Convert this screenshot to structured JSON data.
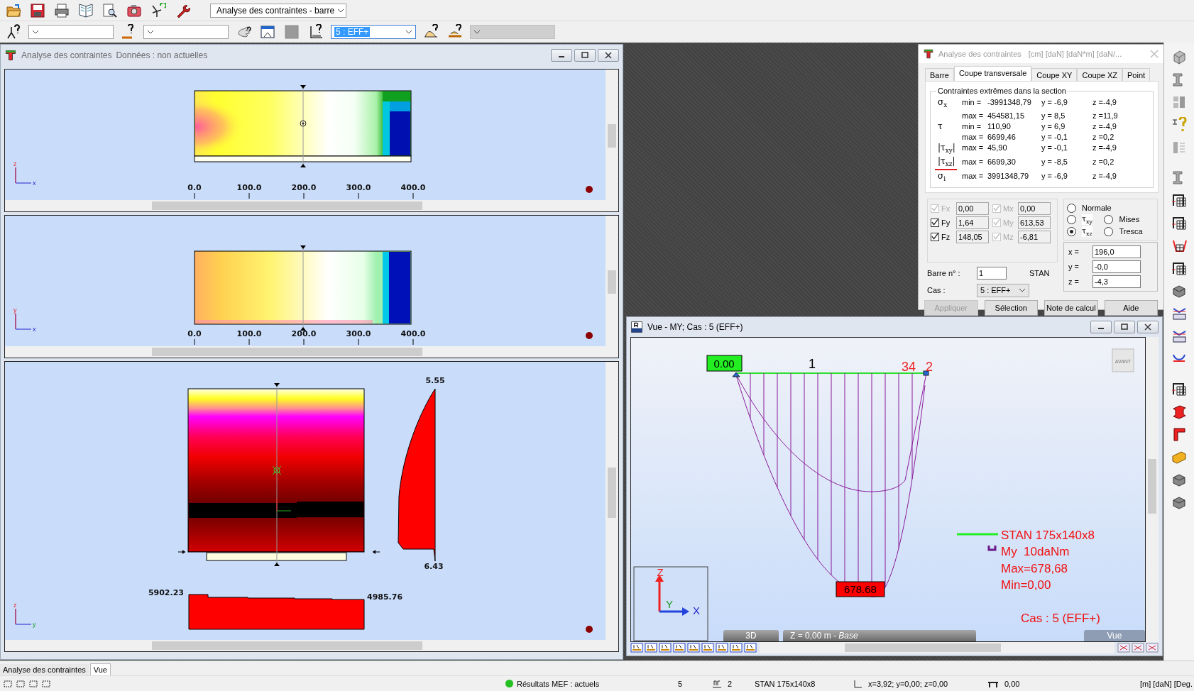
{
  "toolbar": {
    "view_combo": "Analyse des contraintes - barre",
    "case_combo": "5 : EFF+"
  },
  "stress_window": {
    "title": "Analyse des contraintes",
    "subtitle": "Données : non actuelles",
    "panes": [
      {
        "kind": "elevation",
        "axes": [
          "z",
          "x"
        ],
        "ruler": [
          "0.0",
          "100.0",
          "200.0",
          "300.0",
          "400.0"
        ]
      },
      {
        "kind": "plan",
        "axes": [
          "y",
          "x"
        ],
        "ruler": [
          "0.0",
          "100.0",
          "200.0",
          "300.0",
          "400.0"
        ]
      },
      {
        "kind": "section",
        "axes": [
          "z",
          "y"
        ],
        "side_labels": [
          "5.55",
          "6.43"
        ],
        "bottom_labels": [
          "5902.23",
          "4985.76"
        ]
      }
    ]
  },
  "dialog": {
    "title": "Analyse des contraintes",
    "units": "[cm] [daN] [daN*m] [daN/...",
    "tabs": [
      {
        "label": "Barre",
        "selected": false
      },
      {
        "label": "Coupe transversale",
        "selected": true
      },
      {
        "label": "Coupe XY",
        "selected": false
      },
      {
        "label": "Coupe XZ",
        "selected": false
      },
      {
        "label": "Point",
        "selected": false
      }
    ],
    "group_title": "Contraintes extrêmes dans la section",
    "rows": [
      {
        "symbol": "σ$_{x}$",
        "label": "min =",
        "value": "-3991348,79",
        "y": "y = -6,9",
        "z": "z =-4,9",
        "highlighted": false
      },
      {
        "label": "max =",
        "value": "454581,15",
        "y": "y = 8,5",
        "z": "z =11,9",
        "highlighted": false
      },
      {
        "symbol": "τ",
        "label": "min =",
        "value": "110,90",
        "y": "y = 6,9",
        "z": "z =-4,9",
        "highlighted": false
      },
      {
        "label": "max =",
        "value": "6699,46",
        "y": "y = -0,1",
        "z": "z =0,2",
        "highlighted": false
      },
      {
        "symbol": "|τ$_{xy}$|",
        "label": "max =",
        "value": "45,90",
        "y": "y = -0,1",
        "z": "z =-4,9",
        "highlighted": false
      },
      {
        "symbol": "|τ$_{xz}$|",
        "label": "max =",
        "value": "6699,30",
        "y": "y = -8,5",
        "z": "z =0,2",
        "highlighted": true
      },
      {
        "symbol": "σ$_{i}$",
        "label": "max =",
        "value": "3991348,79",
        "y": "y = -6,9",
        "z": "z =-4,9",
        "highlighted": false
      }
    ],
    "forces": [
      {
        "label": "Fx",
        "value": "0,00",
        "checked": true,
        "disabled": true
      },
      {
        "label": "Mx",
        "value": "0,00",
        "checked": true,
        "disabled": true
      },
      {
        "label": "Fy",
        "value": "1,64",
        "checked": true,
        "disabled": false
      },
      {
        "label": "My",
        "value": "613,53",
        "checked": true,
        "disabled": true
      },
      {
        "label": "Fz",
        "value": "148,05",
        "checked": true,
        "disabled": false
      },
      {
        "label": "Mz",
        "value": "-6,81",
        "checked": true,
        "disabled": true
      }
    ],
    "stress_options": [
      {
        "label": "Normale",
        "selected": false
      },
      {
        "label": "τ$_{xy}$",
        "selected": false
      },
      {
        "label": "Mises",
        "selected": false
      },
      {
        "label": "τ$_{xz}$",
        "selected": true
      },
      {
        "label": "Tresca",
        "selected": false
      }
    ],
    "point": [
      {
        "label": "x =",
        "value": "196,0"
      },
      {
        "label": "y =",
        "value": "-0,0"
      },
      {
        "label": "z =",
        "value": "-4,3"
      }
    ],
    "bar": {
      "label": "Barre n° :",
      "value": "1",
      "section": "STAN"
    },
    "case": {
      "label": "Cas :",
      "value": "5 : EFF+"
    },
    "buttons": [
      {
        "label": "Appliquer",
        "disabled": true
      },
      {
        "label": "Sélection",
        "disabled": false
      },
      {
        "label": "Note de calcul",
        "disabled": false
      },
      {
        "label": "Aide",
        "disabled": false
      }
    ]
  },
  "view_window": {
    "title": "Vue - MY; Cas : 5 (EFF+)",
    "start_value": "0.00",
    "bar_number": "1",
    "node_labels": [
      "34",
      "2"
    ],
    "max_value": "678.68",
    "view_button": "AVANT",
    "legend": {
      "section": "STAN 175x140x8",
      "quantity": "My  10daNm",
      "max": "Max=678,68",
      "min": "Min=0,00"
    },
    "case_label": "Cas : 5 (EFF+)",
    "axes": [
      "Z",
      "Y",
      "X"
    ],
    "mode_button": "3D",
    "level": "Z = 0,00 m - *Base*",
    "view_label": "Vue"
  },
  "document_tabs": [
    {
      "label": "Analyse des contraintes",
      "selected": false
    },
    {
      "label": "Vue",
      "selected": true
    }
  ],
  "status_bar": {
    "results_ok": true,
    "results": "Résultats MEF : actuels",
    "case": "5",
    "bar": "2",
    "section": "STAN 175x140x8",
    "coordinates": "x=3,92; y=0,00; z=0,00",
    "angle": "0,00",
    "units": "[m] [daN] [Deg."
  }
}
